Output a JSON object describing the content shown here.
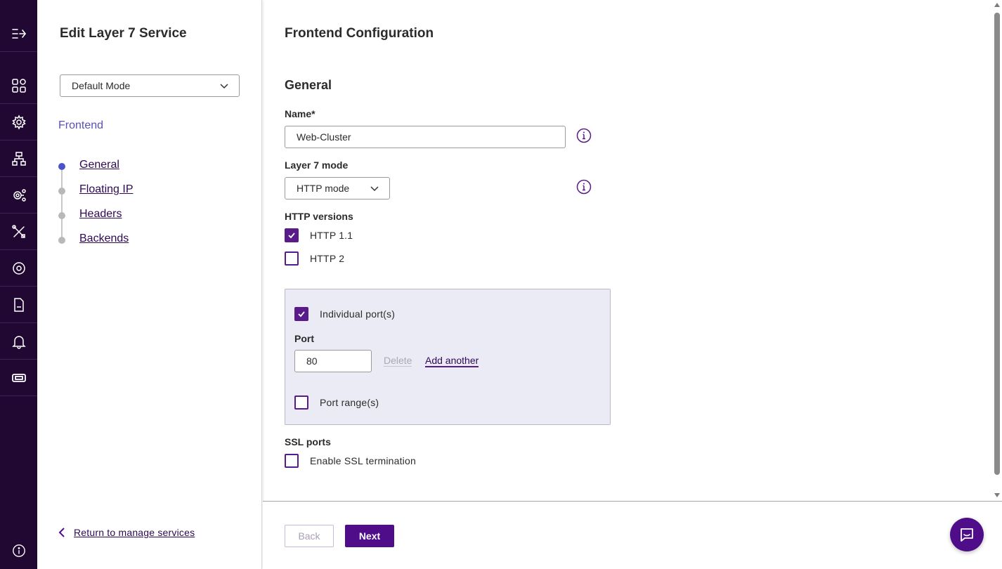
{
  "sidebar": {
    "title": "Edit Layer 7 Service",
    "mode_select": "Default Mode",
    "section": "Frontend",
    "steps": [
      {
        "label": "General",
        "active": true
      },
      {
        "label": "Floating IP",
        "active": false
      },
      {
        "label": "Headers",
        "active": false
      },
      {
        "label": "Backends",
        "active": false
      }
    ],
    "return_label": "Return to manage services"
  },
  "rail": {
    "icons": [
      "menu-expand-icon",
      "dashboard-grid-icon",
      "services-gear-icon",
      "network-icon",
      "cluster-settings-icon",
      "tools-icon",
      "settings-icon",
      "logs-icon",
      "notifications-bell-icon",
      "license-ticket-icon",
      "help-info-icon"
    ]
  },
  "main": {
    "title": "Frontend Configuration",
    "section_title": "General",
    "name_label": "Name*",
    "name_value": "Web-Cluster",
    "layer7_label": "Layer 7 mode",
    "layer7_value": "HTTP mode",
    "http_versions_label": "HTTP versions",
    "http11_label": "HTTP 1.1",
    "http11_checked": true,
    "http2_label": "HTTP 2",
    "http2_checked": false,
    "individual_ports_label": "Individual port(s)",
    "individual_ports_checked": true,
    "port_label": "Port",
    "port_value": "80",
    "delete_label": "Delete",
    "add_another_label": "Add another",
    "port_ranges_label": "Port range(s)",
    "port_ranges_checked": false,
    "ssl_ports_label": "SSL ports",
    "ssl_enable_label": "Enable SSL termination",
    "ssl_enable_checked": false
  },
  "footer": {
    "back_label": "Back",
    "next_label": "Next"
  },
  "colors": {
    "rail_bg": "#200833",
    "accent": "#4f0d8a",
    "link": "#2e0854",
    "section": "#5a50b8",
    "active_step": "#4b53c9"
  }
}
